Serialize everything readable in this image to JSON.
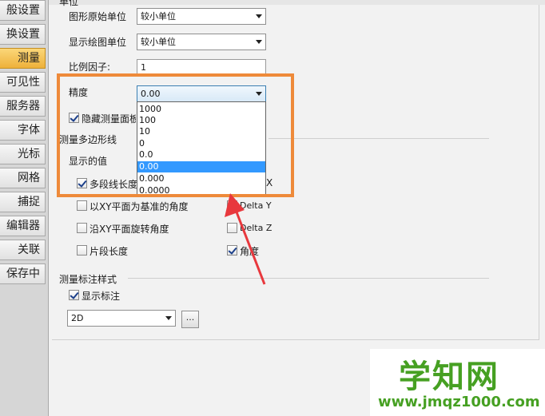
{
  "sidebar": {
    "items": [
      {
        "label": "般设置",
        "selected": false
      },
      {
        "label": "换设置",
        "selected": false
      },
      {
        "label": "测量",
        "selected": true
      },
      {
        "label": "可见性",
        "selected": false
      },
      {
        "label": "服务器",
        "selected": false
      },
      {
        "label": "字体",
        "selected": false
      },
      {
        "label": "光标",
        "selected": false
      },
      {
        "label": "网格",
        "selected": false
      },
      {
        "label": "捕捉",
        "selected": false
      },
      {
        "label": "编辑器",
        "selected": false
      },
      {
        "label": "关联",
        "selected": false
      },
      {
        "label": "保存中",
        "selected": false
      }
    ]
  },
  "units": {
    "group_label": "单位",
    "original_unit_label": "图形原始单位",
    "original_unit_value": "较小单位",
    "display_unit_label": "显示绘图单位",
    "display_unit_value": "较小单位",
    "scale_label": "比例因子:",
    "scale_value": "1",
    "precision_label": "精度",
    "precision_value": "0.00"
  },
  "precision_options": [
    "1000",
    "100",
    "10",
    "0",
    "0.0",
    "0.00",
    "0.000",
    "0.0000"
  ],
  "precision_selected": "0.00",
  "hide_panel": {
    "label": "隐藏测量面板",
    "checked": true
  },
  "polyline": {
    "group_label": "测量多边形线",
    "show_values_label": "显示的值",
    "items": [
      {
        "label": "多段线长度",
        "checked": true
      },
      {
        "label": "以XY平面为基准的角度",
        "checked": false
      },
      {
        "label": "沿XY平面旋转角度",
        "checked": false
      },
      {
        "label": "片段长度",
        "checked": false
      }
    ],
    "right_items": [
      {
        "label": "X",
        "checked": false
      },
      {
        "label": "Delta Y",
        "checked": false
      },
      {
        "label": "Delta Z",
        "checked": false
      },
      {
        "label": "角度",
        "checked": true
      }
    ]
  },
  "annotation_style": {
    "group_label": "测量标注样式",
    "show_label": "显示标注",
    "show_checked": true,
    "style_value": "2D",
    "browse_label": "..."
  },
  "watermark": {
    "title": "学知网",
    "url": "www.jmqz1000.com"
  },
  "colors": {
    "highlight_box": "#ee8a3a",
    "arrow": "#e8383d",
    "selected_option": "#3399ff",
    "selected_tab": "#eeb13a",
    "watermark": "#46a022"
  }
}
